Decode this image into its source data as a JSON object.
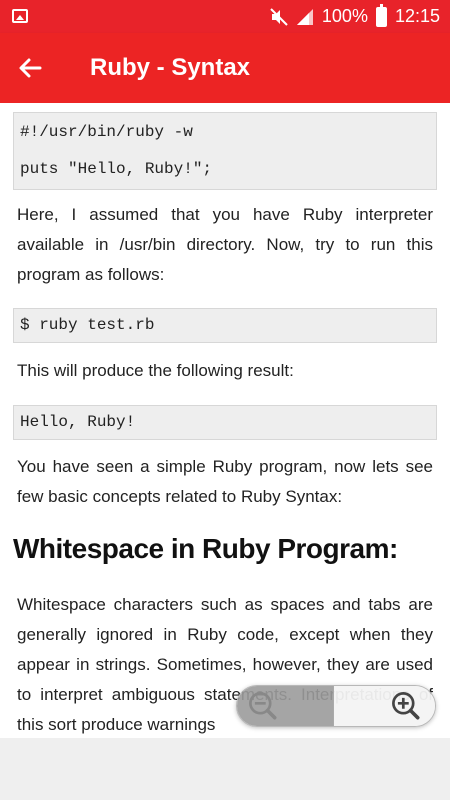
{
  "status_bar": {
    "battery": "100%",
    "time": "12:15",
    "icons": [
      "image-icon",
      "mute-icon",
      "signal-icon",
      "battery-icon"
    ]
  },
  "app_bar": {
    "title": "Ruby - Syntax",
    "back_icon": "arrow-left-icon"
  },
  "content": {
    "code1": {
      "line1": "#!/usr/bin/ruby -w",
      "line2": "puts \"Hello, Ruby!\";"
    },
    "para1": "Here, I assumed that you have Ruby interpreter available in /usr/bin directory. Now, try to run this program as follows:",
    "code2": "$ ruby test.rb",
    "para2": "This will produce the following result:",
    "code3": "Hello, Ruby!",
    "para3": "You have seen a simple Ruby program, now lets see few basic concepts related to Ruby Syntax:",
    "heading": "Whitespace in Ruby Program:",
    "para4": "Whitespace characters such as spaces and tabs are generally ignored in Ruby code, except when they appear in strings. Sometimes, however, they are used to interpret ambiguous statements. Interpretations of this sort produce warnings"
  },
  "zoom": {
    "zoom_out_icon": "zoom-out-icon",
    "zoom_in_icon": "zoom-in-icon"
  },
  "colors": {
    "status_bar": "#e8232a",
    "app_bar": "#ec2424",
    "code_background": "#eeeeee"
  }
}
